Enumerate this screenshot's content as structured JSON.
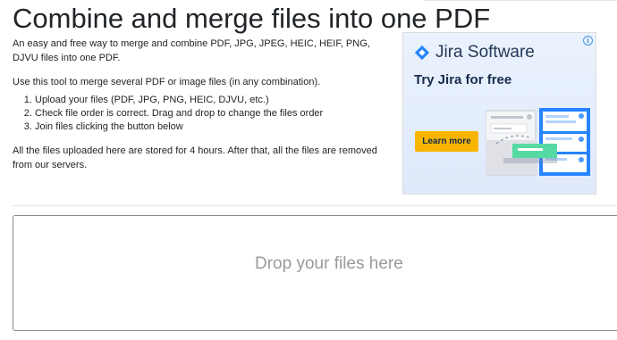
{
  "page": {
    "title": "Combine and merge files into one PDF",
    "intro": "An easy and free way to merge and combine PDF, JPG, JPEG, HEIC, HEIF, PNG, DJVU files into one PDF.",
    "usage": "Use this tool to merge several PDF or image files (in any combination).",
    "steps": [
      "Upload your files (PDF, JPG, PNG, HEIC, DJVU, etc.)",
      "Check file order is correct. Drag and drop to change the files order",
      "Join files clicking the button below"
    ],
    "storage_note": "All the files uploaded here are stored for 4 hours. After that, all the files are removed from our servers."
  },
  "ad": {
    "info_glyph": "i",
    "brand": "Jira Software",
    "headline": "Try Jira for free",
    "cta_label": "Learn more",
    "colors": {
      "brand_blue": "#2684ff",
      "cta_yellow": "#f7b500",
      "card_green": "#57d9a3"
    }
  },
  "dropzone": {
    "label": "Drop your files here"
  }
}
